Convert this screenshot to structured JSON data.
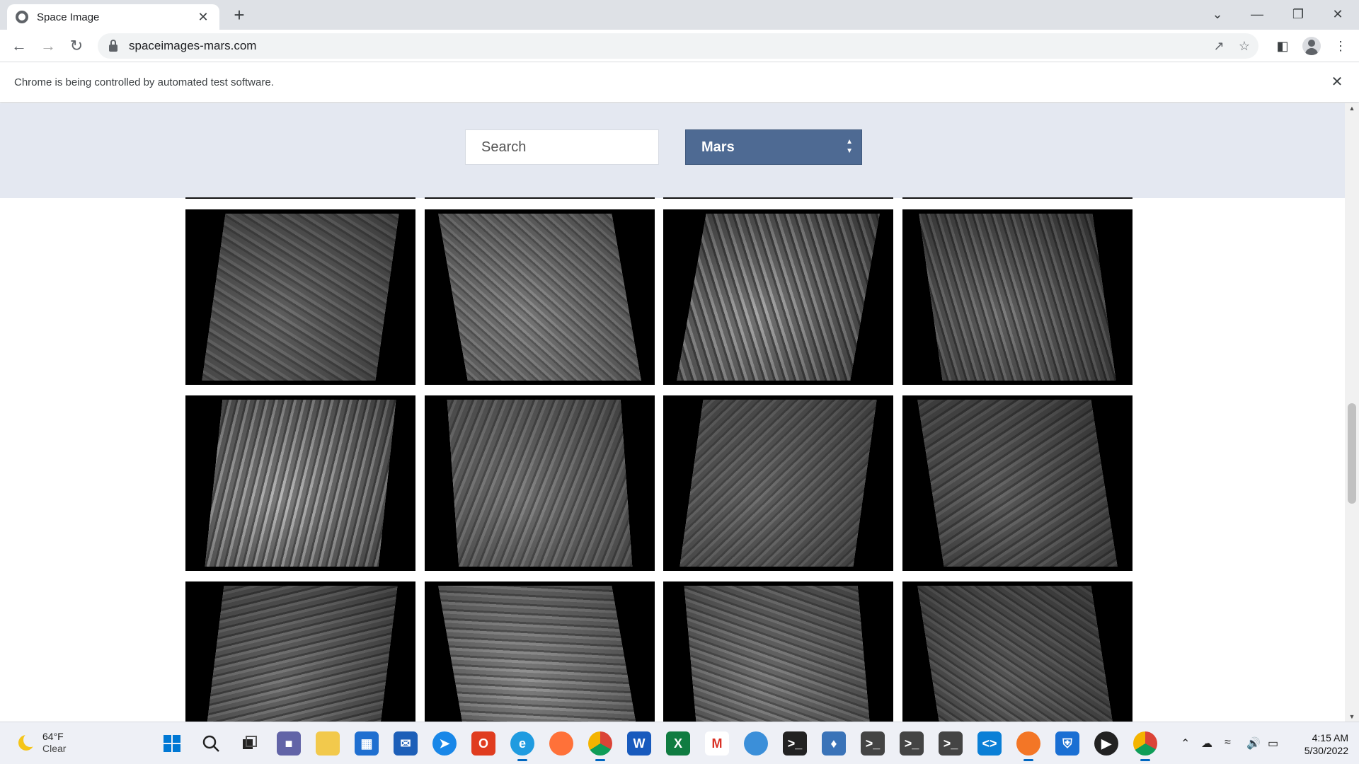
{
  "browser": {
    "tab_title": "Space Image",
    "tab_close": "✕",
    "new_tab": "+",
    "url": "spaceimages-mars.com",
    "infobar_message": "Chrome is being controlled by automated test software.",
    "infobar_close": "✕",
    "window_controls": [
      "⌄",
      "—",
      "❐",
      "✕"
    ]
  },
  "page": {
    "search_placeholder": "Search",
    "planet_select": "Mars",
    "gallery_textures": [
      "craters-mesas",
      "sand-dunes",
      "channel",
      "ridges",
      "slopes",
      "crater-layers",
      "craters-mesas",
      "lava-plains",
      "rough-plains",
      "bright-terrain",
      "crater-layers",
      "lava-plains"
    ]
  },
  "taskbar": {
    "weather_temp": "64°F",
    "weather_condition": "Clear",
    "time": "4:15 AM",
    "date": "5/30/2022"
  }
}
